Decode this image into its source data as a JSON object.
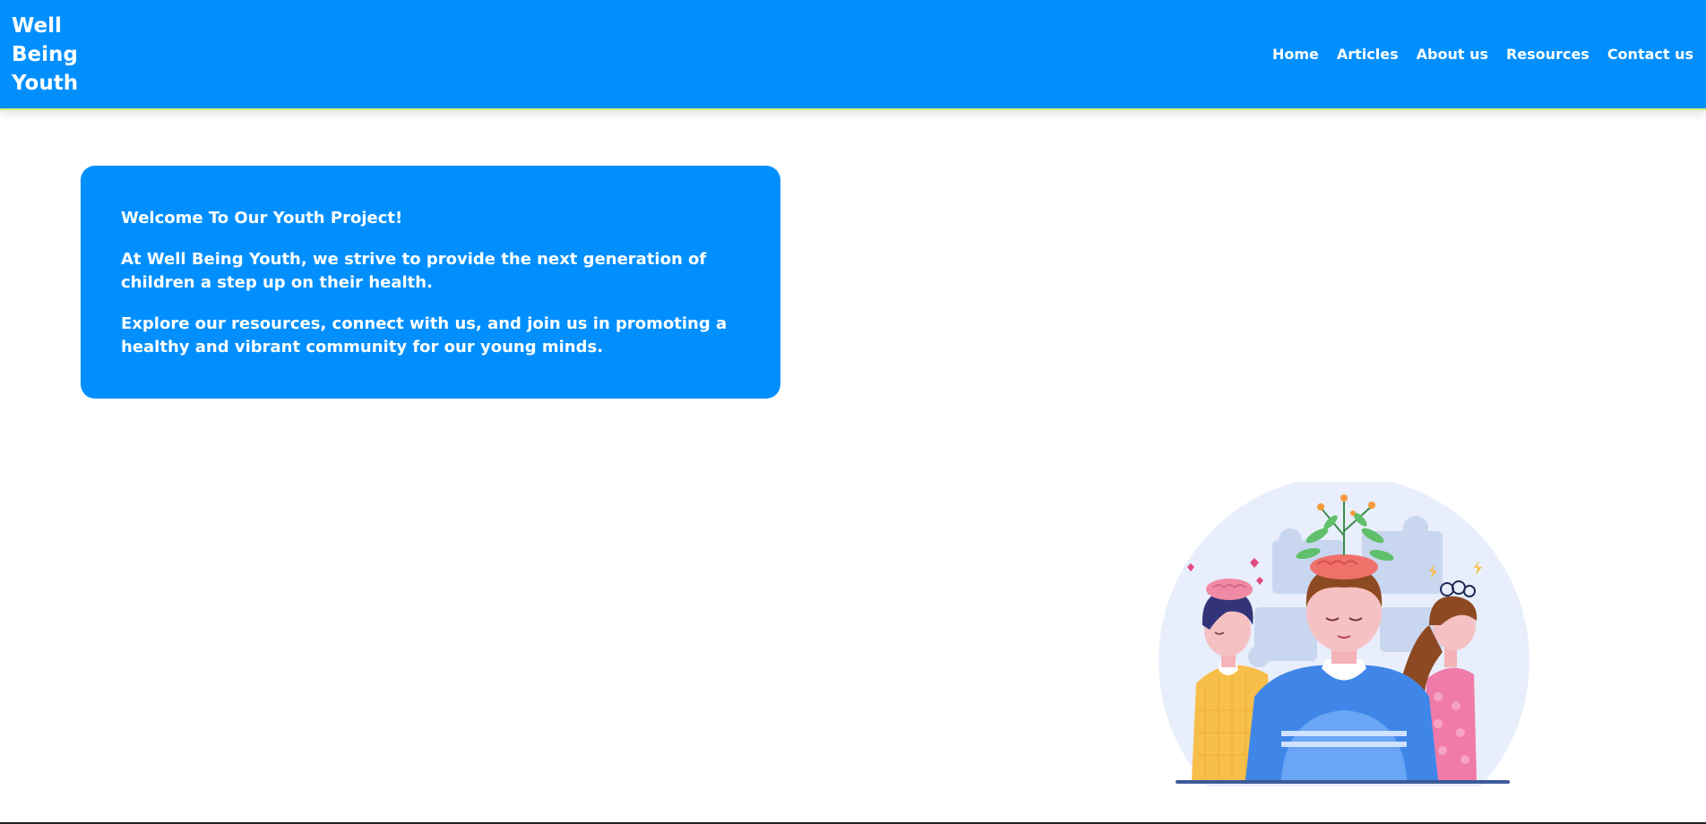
{
  "site": {
    "brand_lines": [
      "Well",
      "Being",
      "Youth"
    ]
  },
  "nav": {
    "items": [
      {
        "label": "Home"
      },
      {
        "label": "Articles"
      },
      {
        "label": "About us"
      },
      {
        "label": "Resources"
      },
      {
        "label": "Contact us"
      }
    ]
  },
  "welcome": {
    "title": "Welcome To Our Youth Project!",
    "paragraph1": "At Well Being Youth, we strive to provide the next generation of children a step up on their health.",
    "paragraph2": "Explore our resources, connect with us, and join us in promoting a healthy and vibrant community for our young minds."
  },
  "hero": {
    "illustration": "mental-health-illustration"
  },
  "colors": {
    "primary": "#018ffe",
    "header_accent": "#d9f27a",
    "text_on_primary": "#ffffff",
    "page_background": "#ffffff"
  }
}
